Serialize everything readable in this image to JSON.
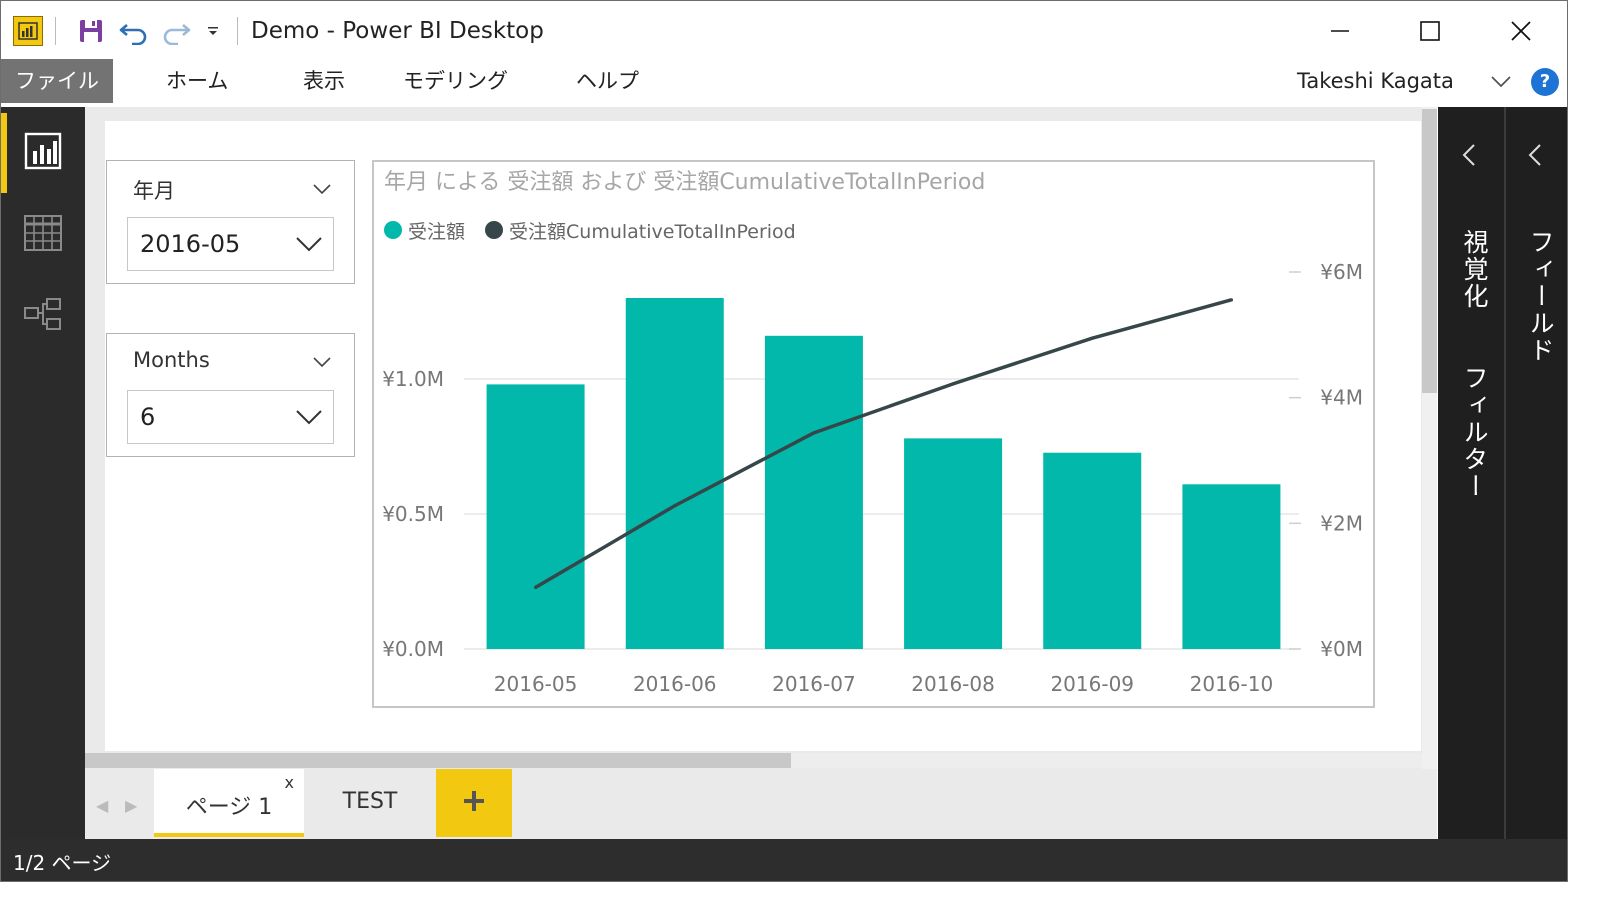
{
  "window": {
    "title": "Demo - Power BI Desktop"
  },
  "menu": {
    "file": "ファイル",
    "home": "ホーム",
    "view": "表示",
    "modeling": "モデリング",
    "help": "ヘルプ"
  },
  "user": {
    "name": "Takeshi Kagata",
    "help_icon": "?"
  },
  "left_rail": {
    "items": [
      {
        "icon": "report-view-icon",
        "active": true
      },
      {
        "icon": "data-view-icon",
        "active": false
      },
      {
        "icon": "relationships-view-icon",
        "active": false
      }
    ]
  },
  "slicers": [
    {
      "title": "年月",
      "value": "2016-05"
    },
    {
      "title": "Months",
      "value": "6"
    }
  ],
  "chart_data": {
    "type": "bar",
    "title": "年月 による 受注額 および 受注額CumulativeTotalInPeriod",
    "categories": [
      "2016-05",
      "2016-06",
      "2016-07",
      "2016-08",
      "2016-09",
      "2016-10"
    ],
    "series": [
      {
        "name": "受注額",
        "type": "bar",
        "axis": "left",
        "color": "#01b8aa",
        "values": [
          980000,
          1300000,
          1160000,
          780000,
          727000,
          610000
        ]
      },
      {
        "name": "受注額CumulativeTotalInPeriod",
        "type": "line",
        "axis": "right",
        "color": "#374649",
        "values": [
          980000,
          2280000,
          3440000,
          4220000,
          4947000,
          5557000
        ]
      }
    ],
    "y_left": {
      "ticks": [
        "¥0.0M",
        "¥0.5M",
        "¥1.0M"
      ],
      "tick_values": [
        0,
        500000,
        1000000
      ],
      "ylim": [
        0,
        1400000
      ]
    },
    "y_right": {
      "ticks": [
        "¥0M",
        "¥2M",
        "¥4M",
        "¥6M"
      ],
      "tick_values": [
        0,
        2000000,
        4000000,
        6000000
      ],
      "ylim": [
        0,
        6000000
      ]
    },
    "grid": true,
    "legend_position": "top-left"
  },
  "page_tabs": {
    "tabs": [
      {
        "label": "ページ 1",
        "active": true,
        "close": "x"
      },
      {
        "label": "TEST",
        "active": false
      }
    ],
    "add": "+"
  },
  "panes": {
    "visualizations": "視覚化",
    "filters": "フィルター",
    "fields": "フィールド"
  },
  "status": {
    "page_indicator": "1/2 ページ"
  },
  "colors": {
    "accent": "#f2c811",
    "bar": "#01b8aa",
    "line": "#374649",
    "pane": "#1f1f1f",
    "rail": "#2b2b2b"
  }
}
